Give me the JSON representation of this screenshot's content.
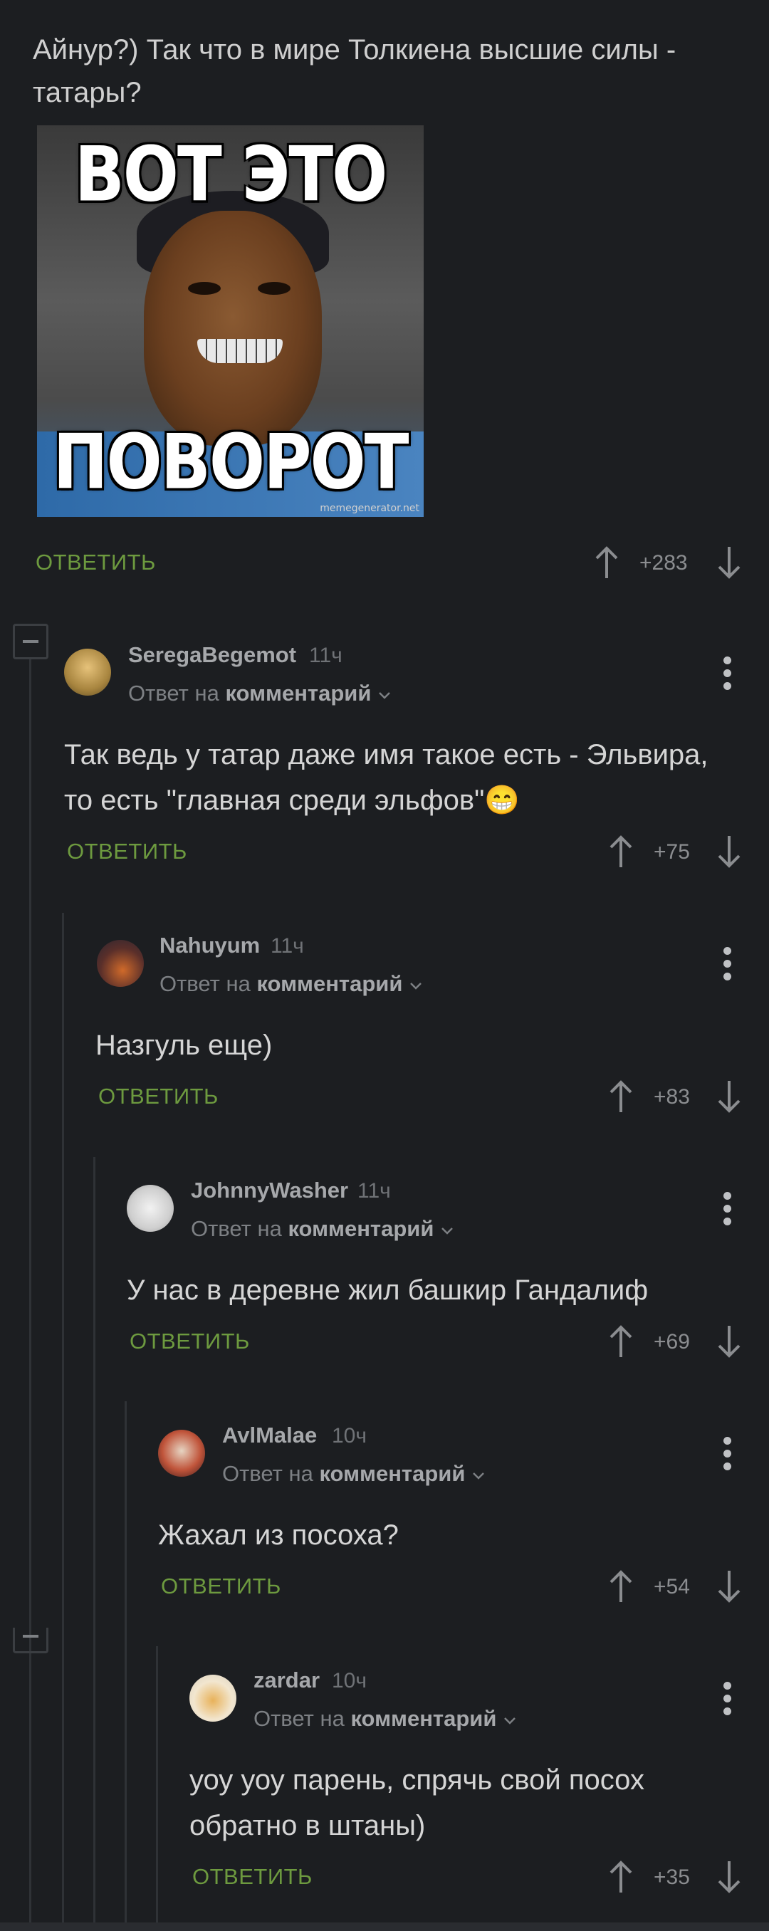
{
  "post_text": "Айнур?) Так что в мире Толкиена высшие силы - татары?",
  "meme": {
    "top_caption": "ВОТ ЭТО",
    "bottom_caption": "ПОВОРОТ",
    "watermark": "memegenerator.net"
  },
  "reply_label": "ОТВЕТИТЬ",
  "reply_to_prefix": "Ответ на",
  "reply_to_target": "комментарий",
  "colors": {
    "accent_green": "#6d9a3f",
    "background": "#1c1e21"
  },
  "top_votes": "+283",
  "comments": [
    {
      "user": "SeregaBegemot",
      "time": "11ч",
      "text": "Так ведь у татар даже имя такое есть - Эльвира, то есть \"главная среди эльфов\"😁",
      "votes": "+75"
    },
    {
      "user": "Nahuyum",
      "time": "11ч",
      "text": "Назгуль еще)",
      "votes": "+83"
    },
    {
      "user": "JohnnyWasher",
      "time": "11ч",
      "text": "У нас в деревне жил башкир Гандалиф",
      "votes": "+69"
    },
    {
      "user": "AvlMalae",
      "time": "10ч",
      "text": "Жахал из посоха?",
      "votes": "+54"
    },
    {
      "user": "zardar",
      "time": "10ч",
      "text": "уоу уоу парень, спрячь свой посох обратно в штаны)",
      "votes": "+35"
    }
  ]
}
